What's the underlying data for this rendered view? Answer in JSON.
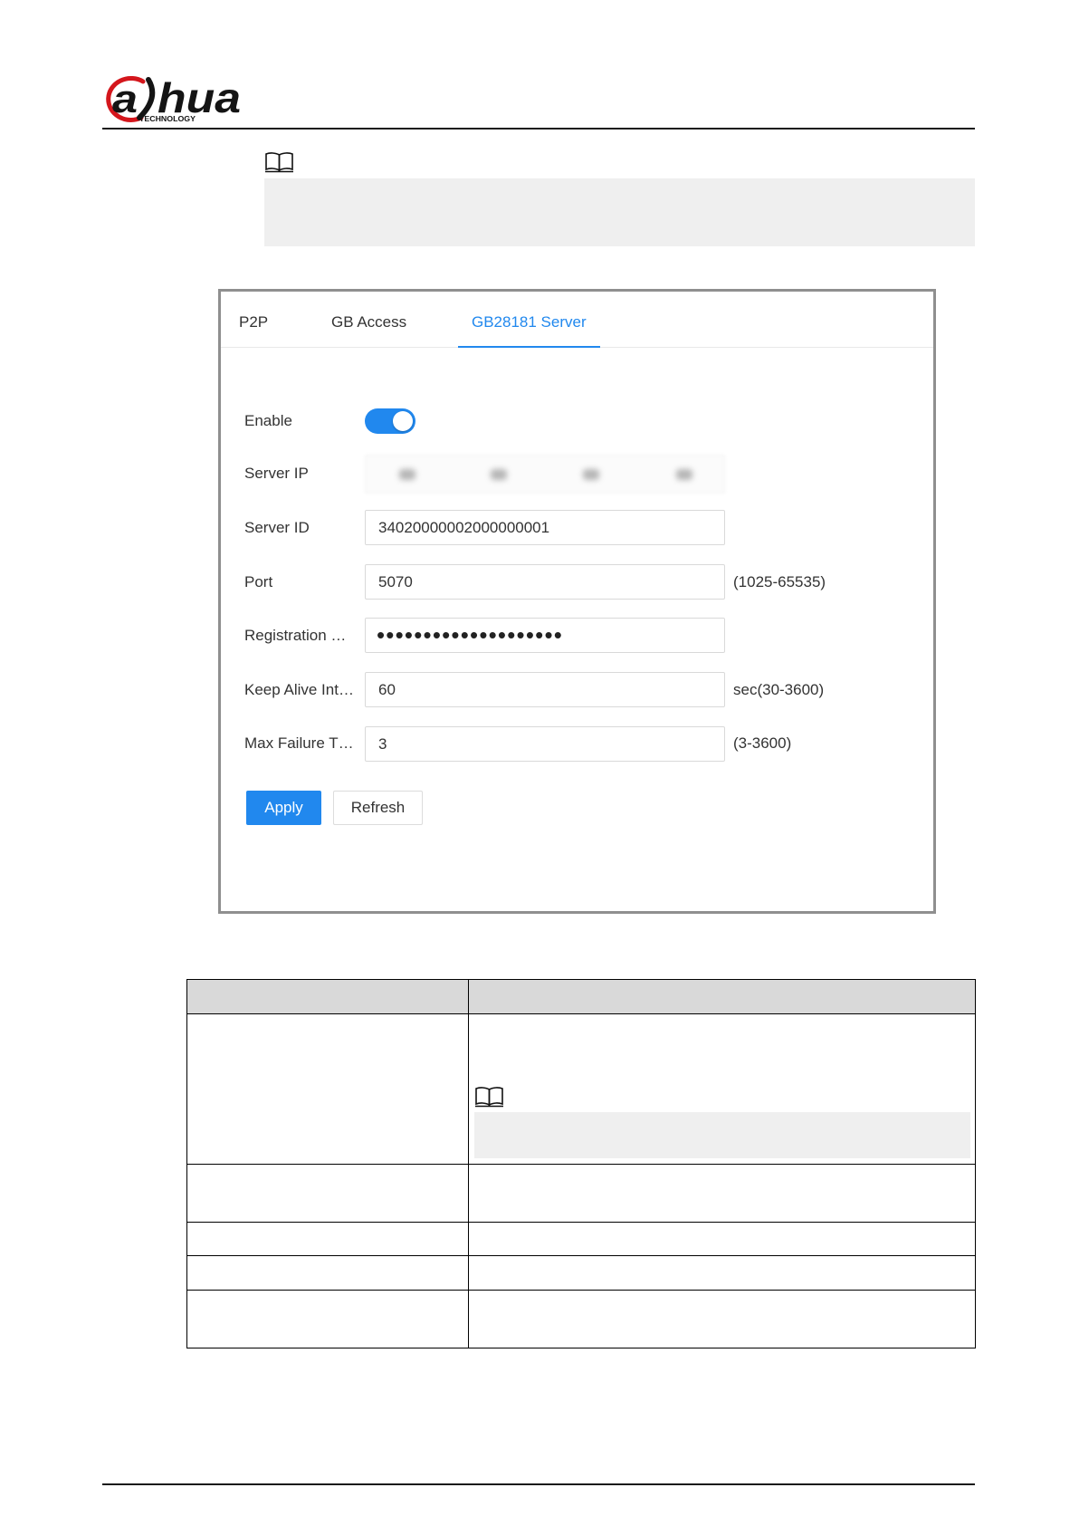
{
  "header": {
    "logo": {
      "mark": "a",
      "word": "hua",
      "tagline": "TECHNOLOGY"
    }
  },
  "icons": {
    "note": "book-note-icon"
  },
  "ui": {
    "tabs": [
      {
        "label": "P2P",
        "active": false
      },
      {
        "label": "GB Access",
        "active": false
      },
      {
        "label": "GB28181 Server",
        "active": true
      }
    ],
    "form": {
      "enable": {
        "label": "Enable",
        "on": true
      },
      "server_ip": {
        "label": "Server IP"
      },
      "server_id": {
        "label": "Server ID",
        "value": "34020000002000000001"
      },
      "port": {
        "label": "Port",
        "value": "5070",
        "hint": "(1025-65535)"
      },
      "registration_password": {
        "label": "Registration …",
        "value": "••••••••••••••••••••"
      },
      "keep_alive_interval": {
        "label": "Keep Alive Int…",
        "value": "60",
        "hint": "sec(30-3600)"
      },
      "max_failure_times": {
        "label": "Max Failure T…",
        "value": "3",
        "hint": "(3-3600)"
      }
    },
    "buttons": {
      "apply": "Apply",
      "refresh": "Refresh"
    }
  },
  "colors": {
    "accent": "#2188ee",
    "brand_red": "#d4161c",
    "note_bg": "#efefef",
    "table_header_bg": "#d9d9d9",
    "frame_border": "#8f8f8f"
  }
}
